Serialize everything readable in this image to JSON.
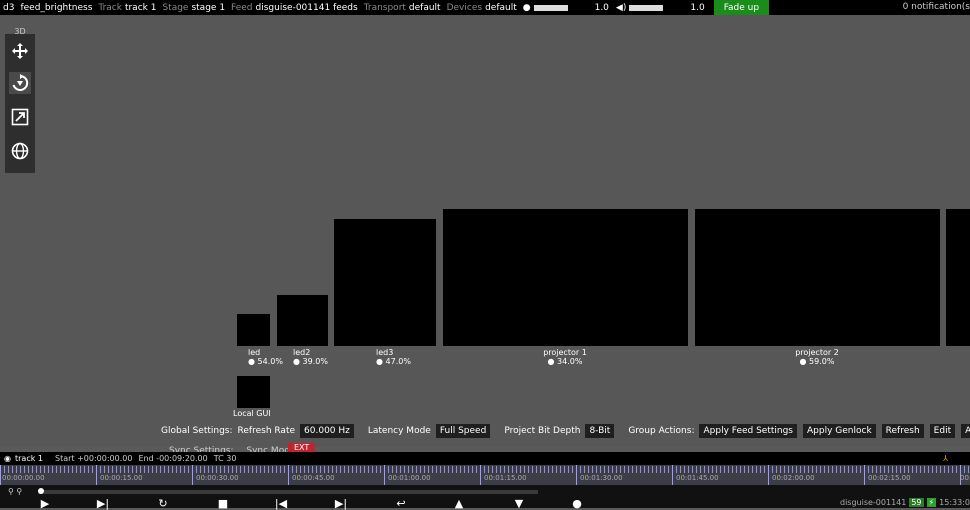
{
  "topbar": {
    "app": "d3",
    "project": "feed_brightness",
    "track_label": "Track",
    "track_value": "track 1",
    "stage_label": "Stage",
    "stage_value": "stage 1",
    "feed_label": "Feed",
    "feed_value": "disguise-001141 feeds",
    "transport_label": "Transport",
    "transport_value": "default",
    "devices_label": "Devices",
    "devices_value": "default",
    "brightness_value": "1.0",
    "volume_value": "1.0",
    "fade_button": "Fade up",
    "notifications": "0 notification(s"
  },
  "toolbox": {
    "mode_label": "3D",
    "tools": [
      "move-icon",
      "rotate-icon",
      "scale-icon",
      "globe-icon"
    ]
  },
  "screens": [
    {
      "name": "led",
      "value": "● 54.0%"
    },
    {
      "name": "led2",
      "value": "● 39.0%"
    },
    {
      "name": "led3",
      "value": "● 47.0%"
    },
    {
      "name": "projector 1",
      "value": "● 34.0%"
    },
    {
      "name": "projector 2",
      "value": "● 59.0%"
    },
    {
      "name": "Local GUI",
      "value": ""
    }
  ],
  "settings": {
    "global_label": "Global Settings:",
    "refresh_label": "Refresh Rate",
    "refresh_value": "60.000 Hz",
    "latency_label": "Latency Mode",
    "latency_value": "Full Speed",
    "bitdepth_label": "Project Bit Depth",
    "bitdepth_value": "8-Bit",
    "group_label": "Group Actions:",
    "apply_feed": "Apply Feed Settings",
    "apply_genlock": "Apply Genlock",
    "refresh_btn": "Refresh",
    "edit_btn": "Edit",
    "apply_ma": "Apply Ma",
    "sync_label": "Sync Settings:",
    "sync_mode_label": "Sync Mode",
    "sync_mode_value": "EXT"
  },
  "timeline": {
    "track": "track 1",
    "start": "Start +00:00:00.00",
    "end": "End -00:09:20.00",
    "tc": "TC 30",
    "ticks": [
      "00:00:00.00",
      "00:00:15.00",
      "00:00:30.00",
      "00:00:45.00",
      "00:01:00.00",
      "00:01:15.00",
      "00:01:30.00",
      "00:01:45.00",
      "00:02:00.00",
      "00:02:15.00",
      "00:"
    ]
  },
  "status": {
    "machine": "disguise-001141",
    "fps": "59",
    "time": "15:33:0"
  },
  "colors": {
    "fade_green": "#1a8c1a",
    "ext_red": "#c0242f",
    "ruler_tick": "#8f8fd8"
  }
}
